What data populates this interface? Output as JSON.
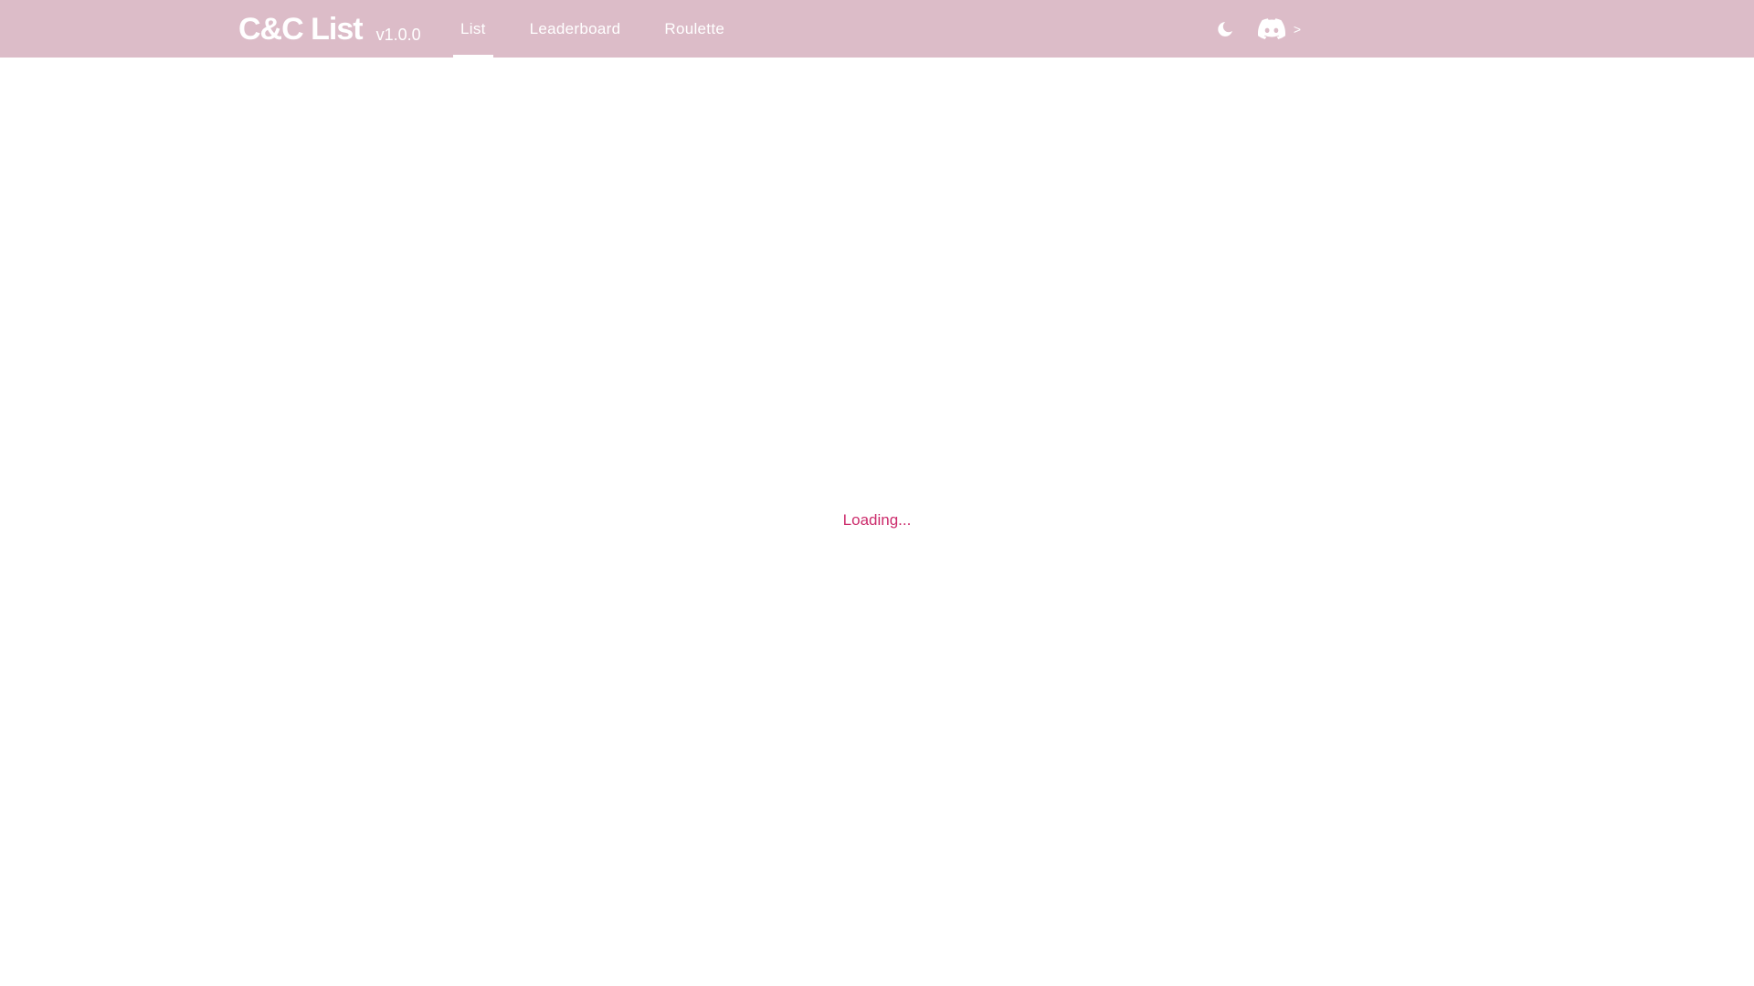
{
  "header": {
    "title": "C&C List",
    "version": "v1.0.0",
    "nav": [
      {
        "label": "List",
        "active": true
      },
      {
        "label": "Leaderboard",
        "active": false
      },
      {
        "label": "Roulette",
        "active": false
      }
    ],
    "icons": {
      "theme_toggle": "moon-icon",
      "discord": "discord-icon"
    },
    "discord_arrow": ">"
  },
  "main": {
    "loading_text": "Loading..."
  },
  "colors": {
    "navbar_bg": "#dcbcc8",
    "accent": "#cc2c6c",
    "nav_text": "#ffffff"
  }
}
